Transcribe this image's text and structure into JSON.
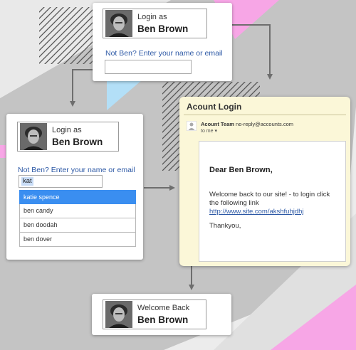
{
  "colors": {
    "background": "#ececec",
    "gray_band": "#c4c4c4",
    "pink": "#f7a6e6",
    "light_blue": "#b3dff7",
    "link": "#2c58a5",
    "highlight": "#3a8ef0",
    "email_bg": "#fbf7d8",
    "arrow": "#707070"
  },
  "step1": {
    "label": "Login as",
    "name": "Ben Brown",
    "prompt": "Not Ben? Enter your name or email"
  },
  "step2": {
    "label": "Login as",
    "name": "Ben Brown",
    "prompt": "Not Ben? Enter your name or email",
    "input_value": "kat",
    "suggestions": [
      "katie spence",
      "ben candy",
      "ben doodah",
      "ben dover"
    ]
  },
  "email": {
    "title": "Acount Login",
    "sender_name": "Acount Team",
    "sender_address": "no-reply@accounts.com",
    "recipient": "to me",
    "recipient_icon": "chevron-down-icon",
    "greeting": "Dear Ben Brown,",
    "message": "Welcome back to our site! - to login click the following link",
    "url": "http://www.site.com/akshfuhjdhj",
    "signoff": "Thankyou,"
  },
  "step4": {
    "label": "Welcome Back",
    "name": "Ben Brown"
  }
}
